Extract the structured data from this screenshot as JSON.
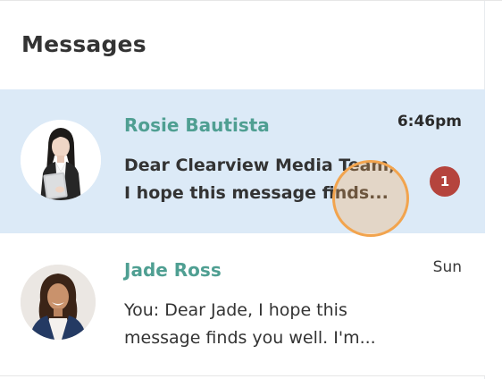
{
  "header": {
    "title": "Messages"
  },
  "threads": [
    {
      "name": "Rosie Bautista",
      "time": "6:46pm",
      "preview_line1": "Dear Clearview Media Team,",
      "preview_line2": "I hope this message finds...",
      "unread_count": "1",
      "active": true,
      "avatar": "woman-with-laptop-avatar"
    },
    {
      "name": "Jade Ross",
      "time": "Sun",
      "preview_line1": "You: Dear Jade, I hope this",
      "preview_line2": "message finds you well. I'm...",
      "active": false,
      "avatar": "woman-smiling-avatar"
    }
  ],
  "colors": {
    "active_row": "#dceaf7",
    "name": "#4f9f92",
    "badge": "#b5443d",
    "cursor_ring": "#f2a44e"
  }
}
